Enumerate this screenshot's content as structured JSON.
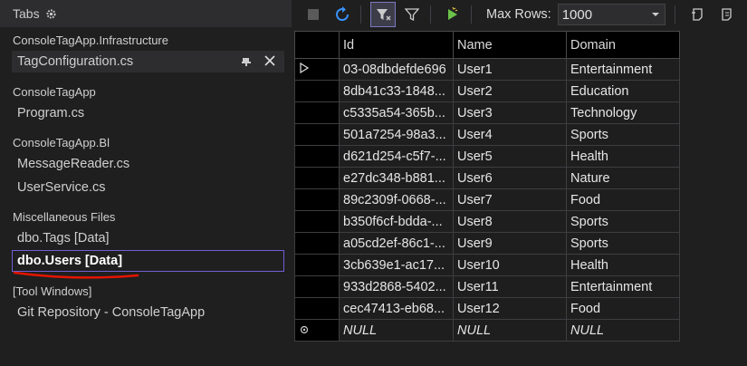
{
  "tabs_panel": {
    "title": "Tabs",
    "groups": [
      {
        "label": "ConsoleTagApp.Infrastructure",
        "items": [
          "TagConfiguration.cs"
        ]
      },
      {
        "label": "ConsoleTagApp",
        "items": [
          "Program.cs"
        ]
      },
      {
        "label": "ConsoleTagApp.Bl",
        "items": [
          "MessageReader.cs",
          "UserService.cs"
        ]
      },
      {
        "label": "Miscellaneous Files",
        "items": [
          "dbo.Tags [Data]",
          "dbo.Users [Data]"
        ]
      },
      {
        "label": "[Tool Windows]",
        "items": [
          "Git Repository - ConsoleTagApp"
        ]
      }
    ]
  },
  "toolbar": {
    "max_rows_label": "Max Rows:",
    "max_rows_value": "1000"
  },
  "grid": {
    "columns": [
      "Id",
      "Name",
      "Domain"
    ],
    "rows": [
      [
        "03-08dbdefde696",
        "User1",
        "Entertainment"
      ],
      [
        "8db41c33-1848...",
        "User2",
        "Education"
      ],
      [
        "c5335a54-365b...",
        "User3",
        "Technology"
      ],
      [
        "501a7254-98a3...",
        "User4",
        "Sports"
      ],
      [
        "d621d254-c5f7-...",
        "User5",
        "Health"
      ],
      [
        "e27dc348-b881...",
        "User6",
        "Nature"
      ],
      [
        "89c2309f-0668-...",
        "User7",
        "Food"
      ],
      [
        "b350f6cf-bdda-...",
        "User8",
        "Sports"
      ],
      [
        "a05cd2ef-86c1-...",
        "User9",
        "Sports"
      ],
      [
        "3cb639e1-ac17...",
        "User10",
        "Health"
      ],
      [
        "933d2868-5402...",
        "User11",
        "Entertainment"
      ],
      [
        "cec47413-eb68...",
        "User12",
        "Food"
      ]
    ],
    "new_row": [
      "NULL",
      "NULL",
      "NULL"
    ]
  },
  "colors": {
    "background": "#1f1f1f",
    "active_border": "#6f5fd6",
    "annotation_red": "#e51400",
    "refresh_blue": "#3794ff",
    "run_green": "#6cc24a"
  }
}
